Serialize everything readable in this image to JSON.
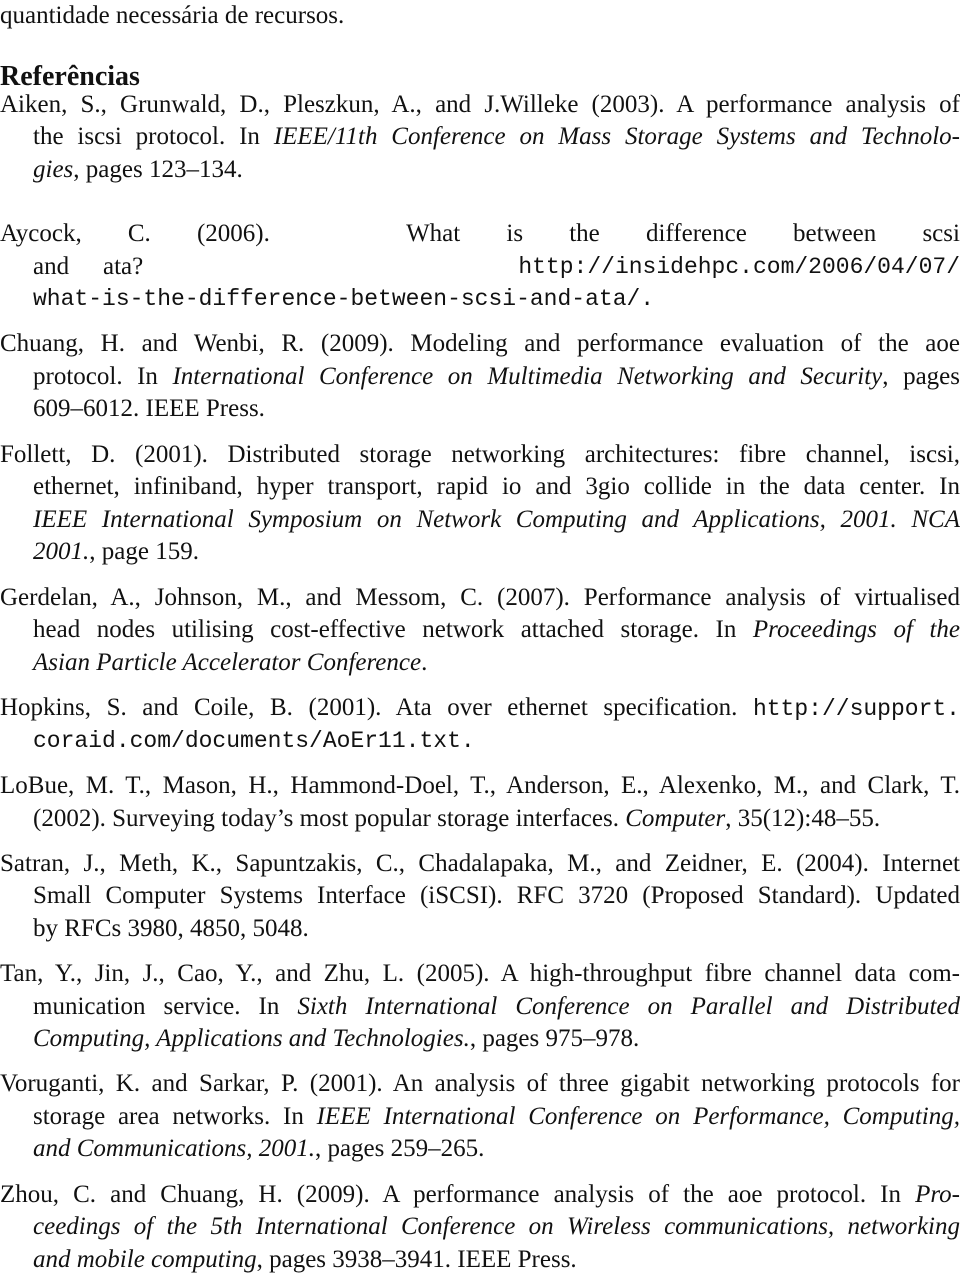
{
  "page": {
    "intro_line": "quantidade necessária de recursos.",
    "heading": "Referências"
  },
  "references": [
    {
      "lines": [
        [
          "Aiken, S., Grunwald, D., Pleszkun, A., and J.Willeke (2003).  A performance analysis of"
        ],
        [
          "the iscsi protocol.  In ",
          "IEEE/11th Conference on Mass Storage Systems and Technolo-"
        ],
        [
          "gies",
          ", pages 123–134."
        ]
      ]
    },
    {
      "lines": [
        [
          "Aycock,",
          "C.",
          "(2006).",
          "What",
          "is",
          "the",
          "difference",
          "between",
          "scsi"
        ],
        [
          "and",
          "ata?",
          "http://insidehpc.com/2006/04/07/"
        ],
        [
          "what-is-the-difference-between-scsi-and-ata/."
        ]
      ]
    },
    {
      "lines": [
        [
          "Chuang, H. and Wenbi, R. (2009).  Modeling and performance evaluation of the aoe"
        ],
        [
          "protocol. In ",
          "International Conference on Multimedia Networking and Security",
          ", pages"
        ],
        [
          "609–6012. IEEE Press."
        ]
      ]
    },
    {
      "lines": [
        [
          "Follett, D. (2001).  Distributed storage networking architectures:  fibre channel, iscsi,"
        ],
        [
          "ethernet, infiniband, hyper transport, rapid io and 3gio collide in the data center.  In"
        ],
        [
          "IEEE International Symposium on Network Computing and Applications, 2001. NCA"
        ],
        [
          "2001.",
          ", page 159."
        ]
      ]
    },
    {
      "lines": [
        [
          "Gerdelan, A., Johnson, M., and Messom, C. (2007).  Performance analysis of virtualised"
        ],
        [
          "head nodes utilising cost-effective network attached storage.  In ",
          "Proceedings of the"
        ],
        [
          "Asian Particle Accelerator Conference",
          "."
        ]
      ]
    },
    {
      "lines": [
        [
          "Hopkins, S. and Coile, B. (2001).  Ata over ethernet specification. ",
          "http://support."
        ],
        [
          "coraid.com/documents/AoEr11.txt."
        ]
      ]
    },
    {
      "lines": [
        [
          "LoBue, M. T., Mason, H., Hammond-Doel, T., Anderson, E., Alexenko, M., and Clark, T."
        ],
        [
          "(2002). Surveying today’s most popular storage interfaces. ",
          "Computer",
          ", 35(12):48–55."
        ]
      ]
    },
    {
      "lines": [
        [
          "Satran, J., Meth, K., Sapuntzakis, C., Chadalapaka, M., and Zeidner, E. (2004).  Internet"
        ],
        [
          "Small Computer Systems Interface (iSCSI). RFC 3720 (Proposed Standard).  Updated"
        ],
        [
          "by RFCs 3980, 4850, 5048."
        ]
      ]
    },
    {
      "lines": [
        [
          "Tan, Y., Jin, J., Cao, Y., and Zhu, L. (2005).  A high-throughput fibre channel data com-"
        ],
        [
          "munication service.   In ",
          "Sixth International Conference on Parallel and Distributed"
        ],
        [
          "Computing, Applications and Technologies.",
          ", pages 975–978."
        ]
      ]
    },
    {
      "lines": [
        [
          "Voruganti, K. and Sarkar, P. (2001).  An analysis of three gigabit networking protocols for"
        ],
        [
          "storage area networks. In ",
          "IEEE International Conference on Performance, Computing,"
        ],
        [
          "and Communications, 2001.",
          ", pages 259–265."
        ]
      ]
    },
    {
      "lines": [
        [
          "Zhou, C. and Chuang, H. (2009).  A performance analysis of the aoe protocol.  In ",
          "Pro-"
        ],
        [
          "ceedings of the 5th International Conference on Wireless communications, networking"
        ],
        [
          "and mobile computing",
          ", pages 3938–3941. IEEE Press."
        ]
      ]
    }
  ]
}
